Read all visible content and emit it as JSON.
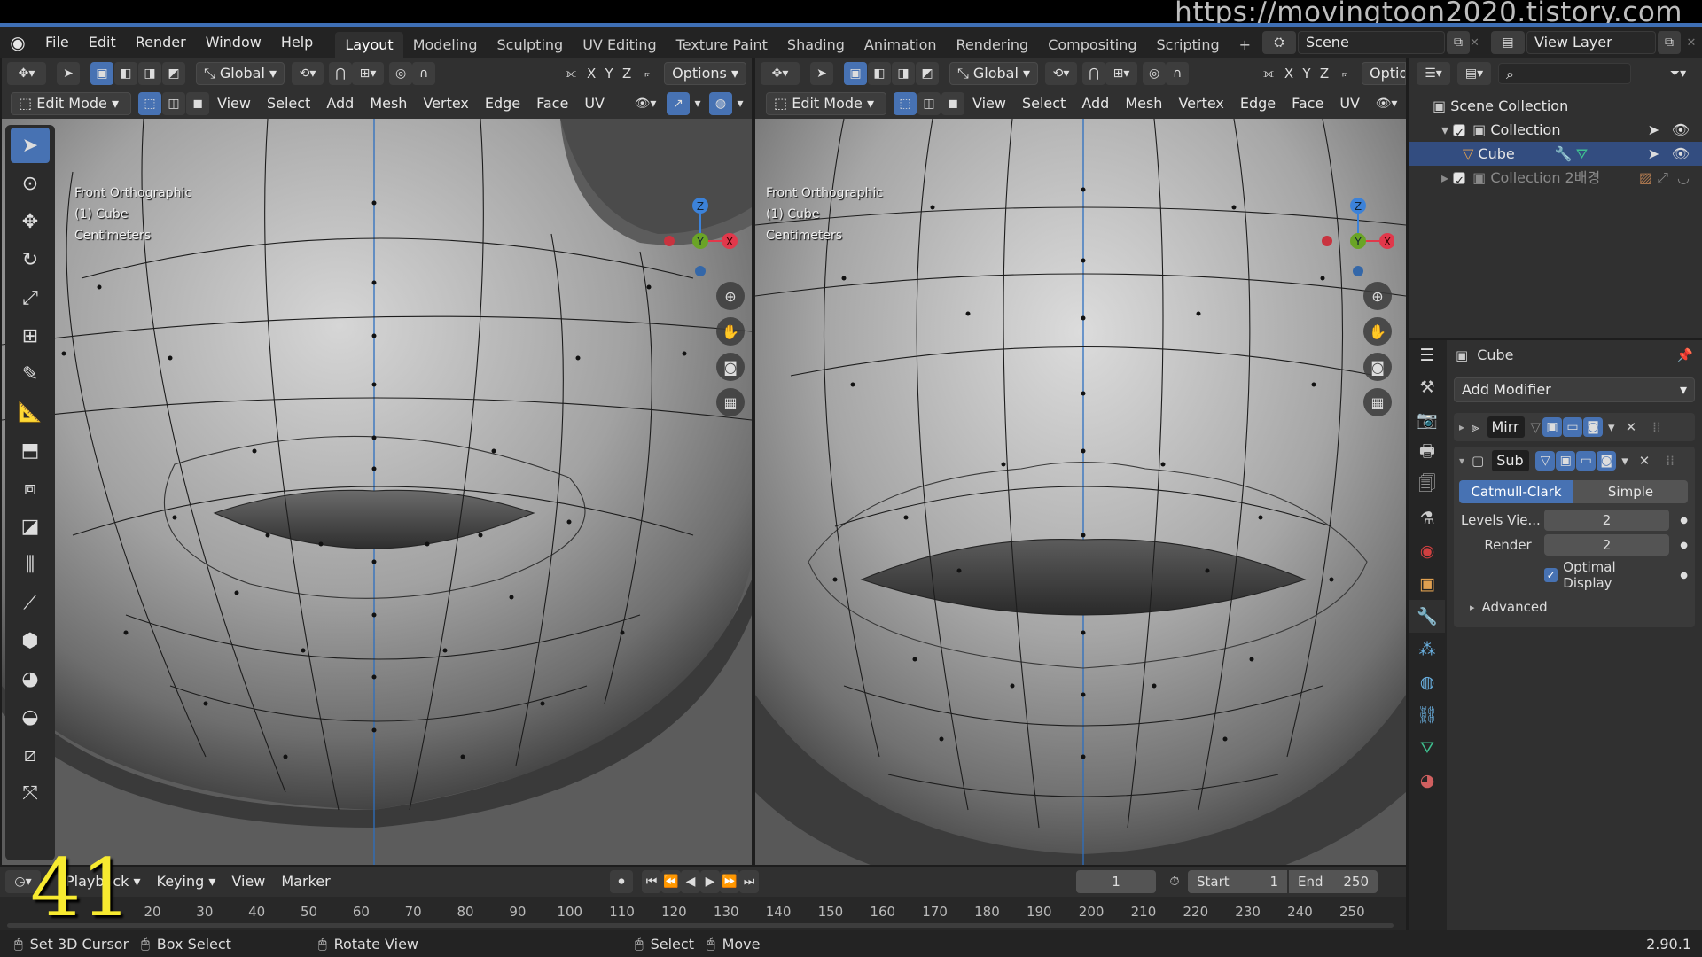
{
  "watermark": "https://movingtoon2020.tistory.com",
  "menu": [
    "File",
    "Edit",
    "Render",
    "Window",
    "Help"
  ],
  "workspaces": [
    "Layout",
    "Modeling",
    "Sculpting",
    "UV Editing",
    "Texture Paint",
    "Shading",
    "Animation",
    "Rendering",
    "Compositing",
    "Scripting"
  ],
  "add_tab": "+",
  "scene": {
    "name": "Scene",
    "view_layer": "View Layer"
  },
  "vp_left": {
    "transform": "Global",
    "axes": [
      "X",
      "Y",
      "Z"
    ],
    "options": "Options",
    "mode": "Edit Mode",
    "menus": [
      "View",
      "Select",
      "Add",
      "Mesh",
      "Vertex",
      "Edge",
      "Face",
      "UV"
    ],
    "overlay_lines": [
      "Front Orthographic",
      "(1) Cube",
      "Centimeters"
    ]
  },
  "vp_right": {
    "transform": "Global",
    "axes": [
      "X",
      "Y",
      "Z"
    ],
    "options": "Optio",
    "mode": "Edit Mode",
    "menus": [
      "View",
      "Select",
      "Add",
      "Mesh",
      "Vertex",
      "Edge",
      "Face",
      "UV"
    ],
    "overlay_lines": [
      "Front Orthographic",
      "(1) Cube",
      "Centimeters"
    ]
  },
  "gizmo": {
    "z": "Z",
    "y": "Y",
    "x": "X",
    "x_color": "#e1384b",
    "y_color": "#6aa426",
    "z_color": "#3c82d9"
  },
  "outliner": {
    "root": "Scene Collection",
    "items": [
      {
        "label": "Collection",
        "level": 1
      },
      {
        "label": "Cube",
        "level": 2,
        "selected": true
      },
      {
        "label": "Collection 2배경",
        "level": 1,
        "dim": true
      }
    ]
  },
  "properties": {
    "object": "Cube",
    "add_modifier": "Add Modifier",
    "modifiers": [
      {
        "name": "Mirr",
        "expanded": false
      },
      {
        "name": "Sub",
        "expanded": true
      }
    ],
    "subdiv_types": [
      "Catmull-Clark",
      "Simple"
    ],
    "levels_label": "Levels Vie...",
    "levels_value": "2",
    "render_label": "Render",
    "render_value": "2",
    "optimal_display": "Optimal Display",
    "advanced": "Advanced"
  },
  "timeline": {
    "playback": "Playback",
    "keying": "Keying",
    "view": "View",
    "marker": "Marker",
    "current_frame": "1",
    "start_label": "Start",
    "start": "1",
    "end_label": "End",
    "end": "250",
    "ticks": [
      "20",
      "30",
      "40",
      "50",
      "60",
      "70",
      "80",
      "90",
      "100",
      "110",
      "120",
      "130",
      "140",
      "150",
      "160",
      "170",
      "180",
      "190",
      "200",
      "210",
      "220",
      "230",
      "240",
      "250"
    ]
  },
  "status": {
    "items": [
      "Set 3D Cursor",
      "Box Select",
      "Rotate View",
      "Select",
      "Move"
    ],
    "version": "2.90.1"
  },
  "counter": "41"
}
